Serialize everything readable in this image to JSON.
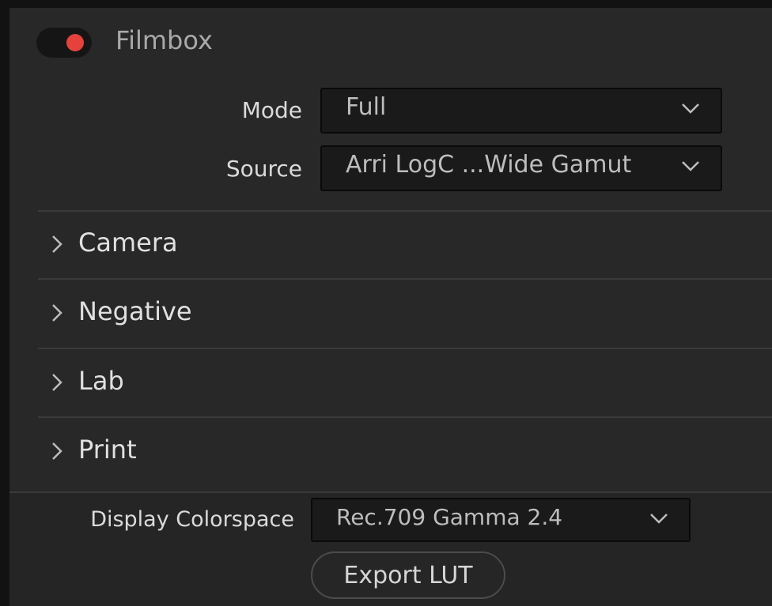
{
  "header": {
    "enabled": true,
    "title": "Filmbox"
  },
  "fields": {
    "mode": {
      "label": "Mode",
      "value": "Full"
    },
    "source": {
      "label": "Source",
      "value": "Arri LogC ...Wide Gamut"
    }
  },
  "sections": [
    {
      "label": "Camera"
    },
    {
      "label": "Negative"
    },
    {
      "label": "Lab"
    },
    {
      "label": "Print"
    }
  ],
  "footer": {
    "display_colorspace": {
      "label": "Display Colorspace",
      "value": "Rec.709 Gamma 2.4"
    },
    "export_label": "Export LUT"
  },
  "colors": {
    "toggle_on": "#e5423c",
    "panel": "#282828",
    "background": "#121212"
  },
  "icons": {
    "toggle": "power-toggle-icon",
    "dropdown": "chevron-down-icon",
    "section": "chevron-right-icon"
  }
}
